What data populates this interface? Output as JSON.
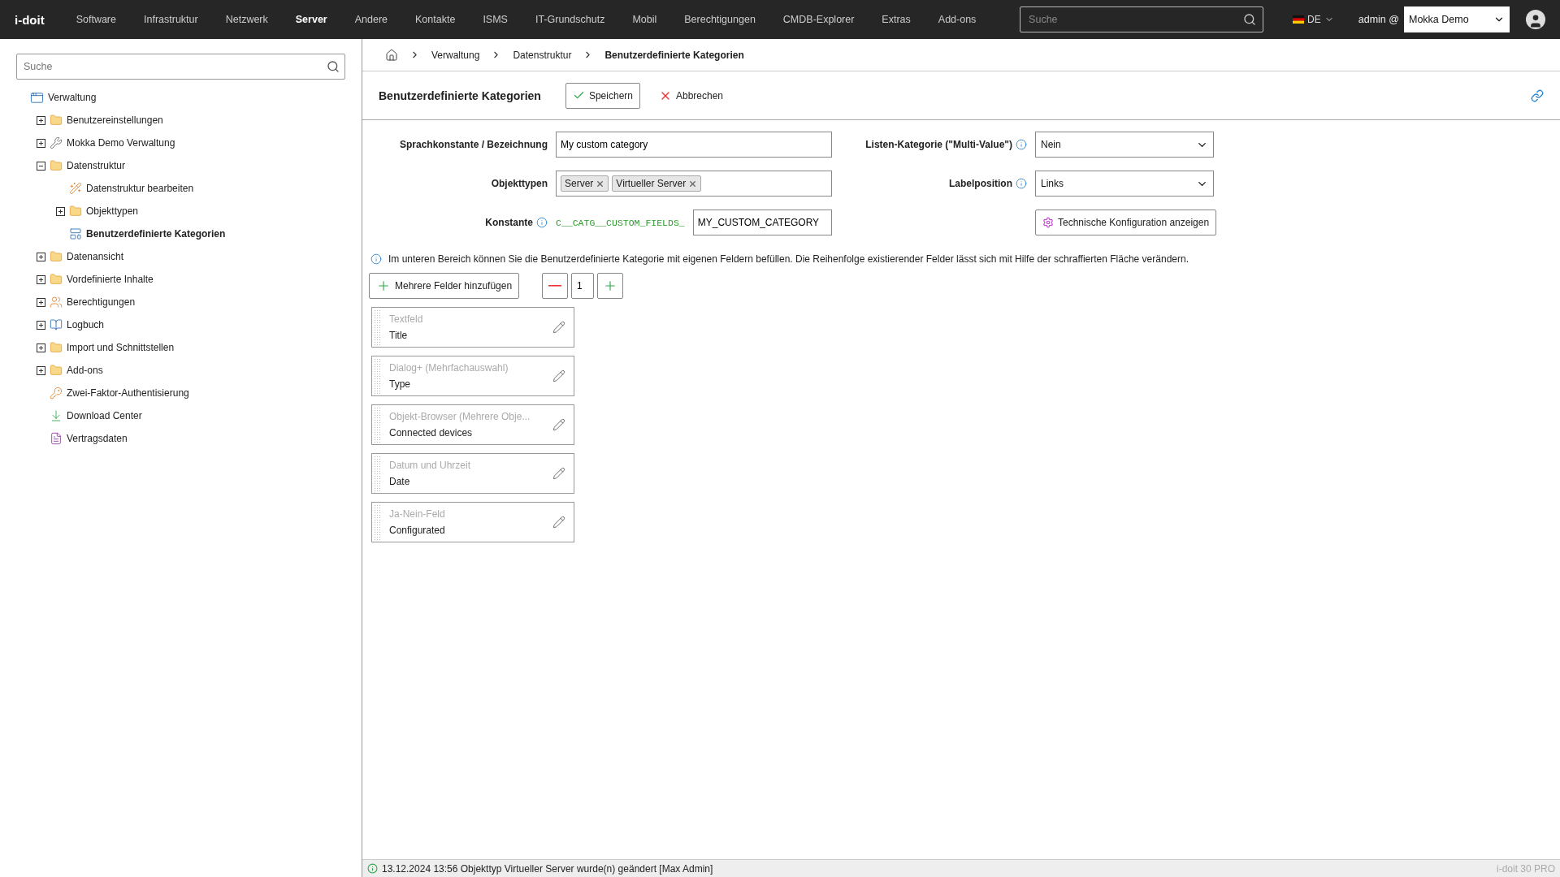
{
  "topbar": {
    "logo": "i-doit",
    "nav": [
      {
        "label": "Software",
        "selected": false
      },
      {
        "label": "Infrastruktur",
        "selected": false
      },
      {
        "label": "Netzwerk",
        "selected": false
      },
      {
        "label": "Server",
        "selected": true
      },
      {
        "label": "Andere",
        "selected": false
      },
      {
        "label": "Kontakte",
        "selected": false
      },
      {
        "label": "ISMS",
        "selected": false
      },
      {
        "label": "IT-Grundschutz",
        "selected": false
      },
      {
        "label": "Mobil",
        "selected": false
      },
      {
        "label": "Berechtigungen",
        "selected": false
      },
      {
        "label": "CMDB-Explorer",
        "selected": false
      },
      {
        "label": "Extras",
        "selected": false
      },
      {
        "label": "Add-ons",
        "selected": false
      }
    ],
    "search": {
      "placeholder": "Suche"
    },
    "language": "DE",
    "user": "admin @",
    "tenant": "Mokka Demo"
  },
  "sidebar": {
    "search": {
      "placeholder": "Suche"
    },
    "tree": [
      {
        "label": "Verwaltung",
        "kind": "window",
        "selected": false,
        "children": [
          {
            "label": "Benutzereinstellungen",
            "kind": "folder",
            "expanded": false,
            "selected": false
          },
          {
            "label": "Mokka Demo Verwaltung",
            "kind": "wrench",
            "expanded": false,
            "selected": false
          },
          {
            "label": "Datenstruktur",
            "kind": "folder",
            "expanded": true,
            "selected": false,
            "children": [
              {
                "label": "Datenstruktur bearbeiten",
                "kind": "wand",
                "selected": false
              },
              {
                "label": "Objekttypen",
                "kind": "folder",
                "expanded": false,
                "selected": false
              },
              {
                "label": "Benutzerdefinierte Kategorien",
                "kind": "form",
                "selected": true
              }
            ]
          },
          {
            "label": "Datenansicht",
            "kind": "folder",
            "expanded": false,
            "selected": false
          },
          {
            "label": "Vordefinierte Inhalte",
            "kind": "folder",
            "expanded": false,
            "selected": false
          },
          {
            "label": "Berechtigungen",
            "kind": "users",
            "expanded": false,
            "selected": false
          },
          {
            "label": "Logbuch",
            "kind": "book",
            "expanded": false,
            "selected": false
          },
          {
            "label": "Import und Schnittstellen",
            "kind": "folder",
            "expanded": false,
            "selected": false
          },
          {
            "label": "Add-ons",
            "kind": "folder",
            "expanded": false,
            "selected": false
          },
          {
            "label": "Zwei-Faktor-Authentisierung",
            "kind": "key",
            "selected": false
          },
          {
            "label": "Download Center",
            "kind": "download",
            "selected": false
          },
          {
            "label": "Vertragsdaten",
            "kind": "document",
            "selected": false
          }
        ]
      }
    ]
  },
  "breadcrumb": [
    "Verwaltung",
    "Datenstruktur",
    "Benutzerdefinierte Kategorien"
  ],
  "header": {
    "title": "Benutzerdefinierte Kategorien",
    "save": "Speichern",
    "cancel": "Abbrechen"
  },
  "form": {
    "name_label": "Sprachkonstante / Bezeichnung",
    "name_value": "My custom category",
    "types_label": "Objekttypen",
    "types": [
      "Server",
      "Virtueller Server"
    ],
    "constant_label": "Konstante",
    "constant_prefix": "C__CATG__CUSTOM_FIELDS_",
    "constant_value": "MY_CUSTOM_CATEGORY",
    "multi_label": "Listen-Kategorie (\"Multi-Value\")",
    "multi_value": "Nein",
    "labelpos_label": "Labelposition",
    "labelpos_value": "Links",
    "tech_button": "Technische Konfiguration anzeigen"
  },
  "hint": "Im unteren Bereich können Sie die Benutzerdefinierte Kategorie mit eigenen Feldern befüllen. Die Reihenfolge existierender Felder lässt sich mit Hilfe der schraffierten Fläche verändern.",
  "add_button": "Mehrere Felder hinzufügen",
  "count": "1",
  "fields": [
    {
      "type": "Textfeld",
      "name": "Title"
    },
    {
      "type": "Dialog+ (Mehrfachauswahl)",
      "name": "Type"
    },
    {
      "type": "Objekt-Browser (Mehrere Obje...",
      "name": "Connected devices"
    },
    {
      "type": "Datum und Uhrzeit",
      "name": "Date"
    },
    {
      "type": "Ja-Nein-Feld",
      "name": "Configurated"
    }
  ],
  "status_bar": {
    "message": "13.12.2024 13:56 Objekttyp Virtueller Server wurde(n) geändert [Max Admin]",
    "version": "i-doit 30 PRO"
  }
}
